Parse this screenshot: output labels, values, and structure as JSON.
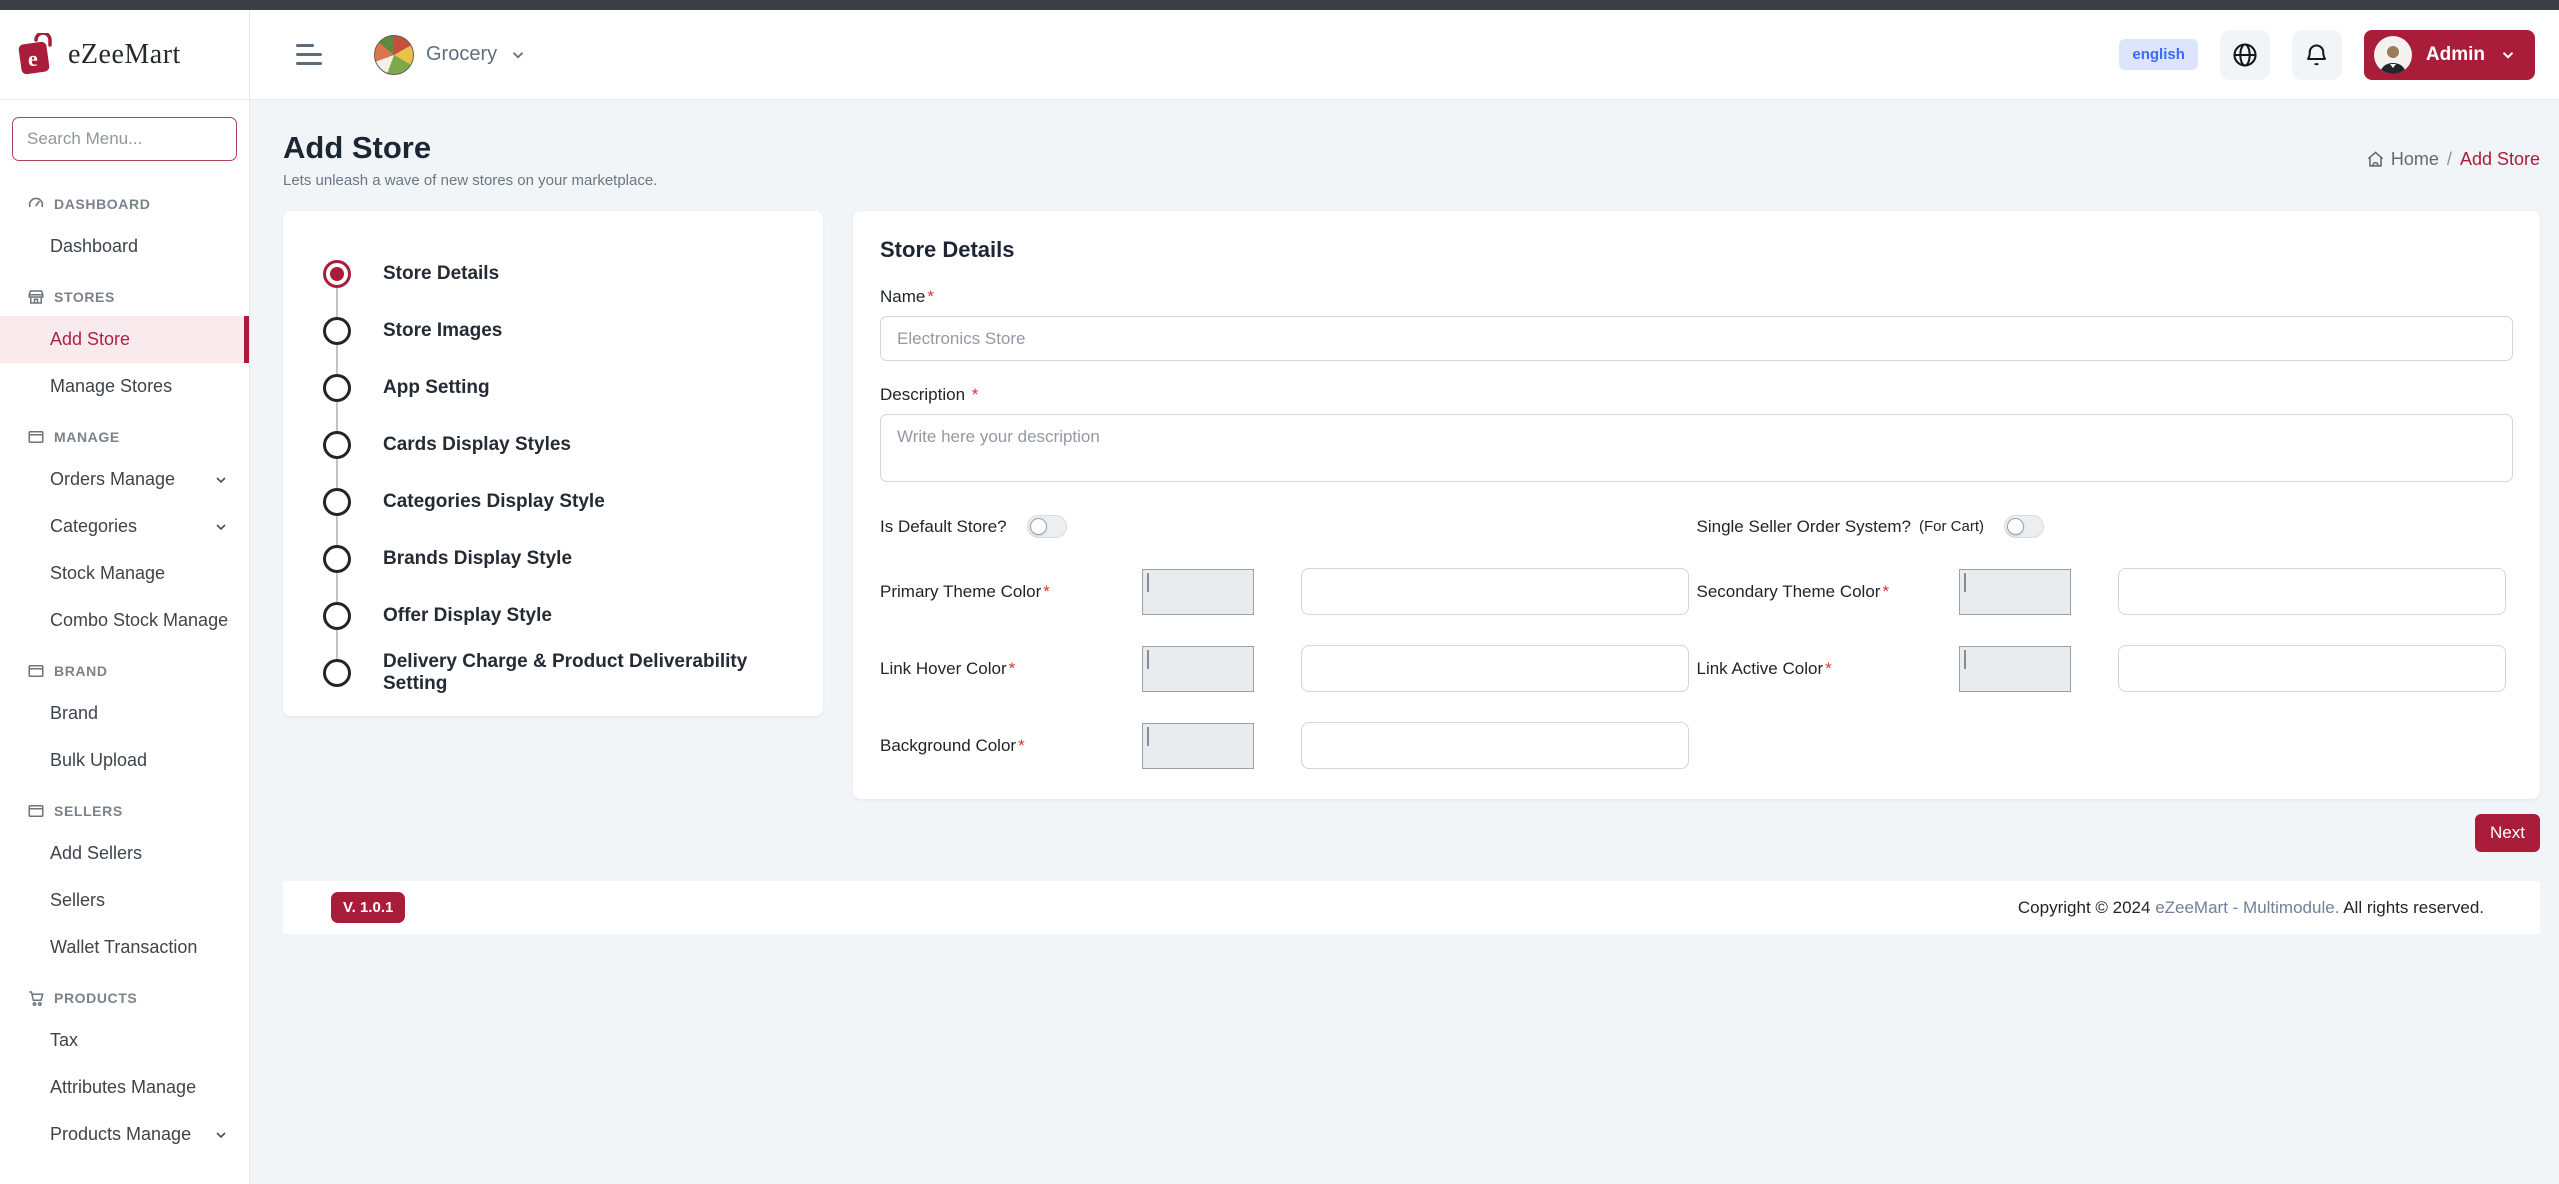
{
  "brand": {
    "name": "eZeeMart"
  },
  "sidebar": {
    "search_placeholder": "Search Menu...",
    "sections": [
      {
        "label": "DASHBOARD",
        "items": [
          {
            "label": "Dashboard"
          }
        ]
      },
      {
        "label": "STORES",
        "items": [
          {
            "label": "Add Store"
          },
          {
            "label": "Manage Stores"
          }
        ]
      },
      {
        "label": "MANAGE",
        "items": [
          {
            "label": "Orders Manage"
          },
          {
            "label": "Categories"
          },
          {
            "label": "Stock Manage"
          },
          {
            "label": "Combo Stock Manage"
          }
        ]
      },
      {
        "label": "BRAND",
        "items": [
          {
            "label": "Brand"
          },
          {
            "label": "Bulk Upload"
          }
        ]
      },
      {
        "label": "SELLERS",
        "items": [
          {
            "label": "Add Sellers"
          },
          {
            "label": "Sellers"
          },
          {
            "label": "Wallet Transaction"
          }
        ]
      },
      {
        "label": "PRODUCTS",
        "items": [
          {
            "label": "Tax"
          },
          {
            "label": "Attributes Manage"
          },
          {
            "label": "Products Manage"
          }
        ]
      }
    ]
  },
  "header": {
    "store_switcher_label": "Grocery",
    "language_badge": "english",
    "admin_label": "Admin"
  },
  "page": {
    "title": "Add Store",
    "subtitle": "Lets unleash a wave of new stores on your marketplace.",
    "breadcrumb": {
      "home": "Home",
      "separator": "/",
      "current": "Add Store"
    }
  },
  "stepper": {
    "active_index": 0,
    "steps": [
      {
        "label": "Store Details"
      },
      {
        "label": "Store Images"
      },
      {
        "label": "App Setting"
      },
      {
        "label": "Cards Display Styles"
      },
      {
        "label": "Categories Display Style"
      },
      {
        "label": "Brands Display Style"
      },
      {
        "label": "Offer Display Style"
      },
      {
        "label": "Delivery Charge & Product Deliverability Setting"
      }
    ]
  },
  "form": {
    "heading": "Store Details",
    "required_mark": "*",
    "name": {
      "label": "Name",
      "placeholder": "Electronics Store"
    },
    "description": {
      "label": "Description",
      "placeholder": "Write here your description"
    },
    "toggles": {
      "default_store": {
        "label": "Is Default Store?"
      },
      "single_seller": {
        "label": "Single Seller Order System?",
        "suffix": "(For Cart)"
      }
    },
    "colors": {
      "primary": {
        "label": "Primary Theme Color"
      },
      "secondary": {
        "label": "Secondary Theme Color"
      },
      "link_hover": {
        "label": "Link Hover Color"
      },
      "link_active": {
        "label": "Link Active Color"
      },
      "background": {
        "label": "Background Color"
      }
    },
    "swatch_color": "#d6f6df",
    "next_label": "Next"
  },
  "footer": {
    "version": "V. 1.0.1",
    "copyright_prefix": "Copyright © 2024",
    "copyright_link": "eZeeMart - Multimodule.",
    "copyright_suffix": "All rights reserved."
  },
  "theme": {
    "accent": "#a91d3a",
    "accent_soft_bg": "#f9eaee",
    "language_badge_bg": "#dde5fd",
    "language_badge_text": "#3d6bf5",
    "content_bg": "#f1f5f8"
  }
}
